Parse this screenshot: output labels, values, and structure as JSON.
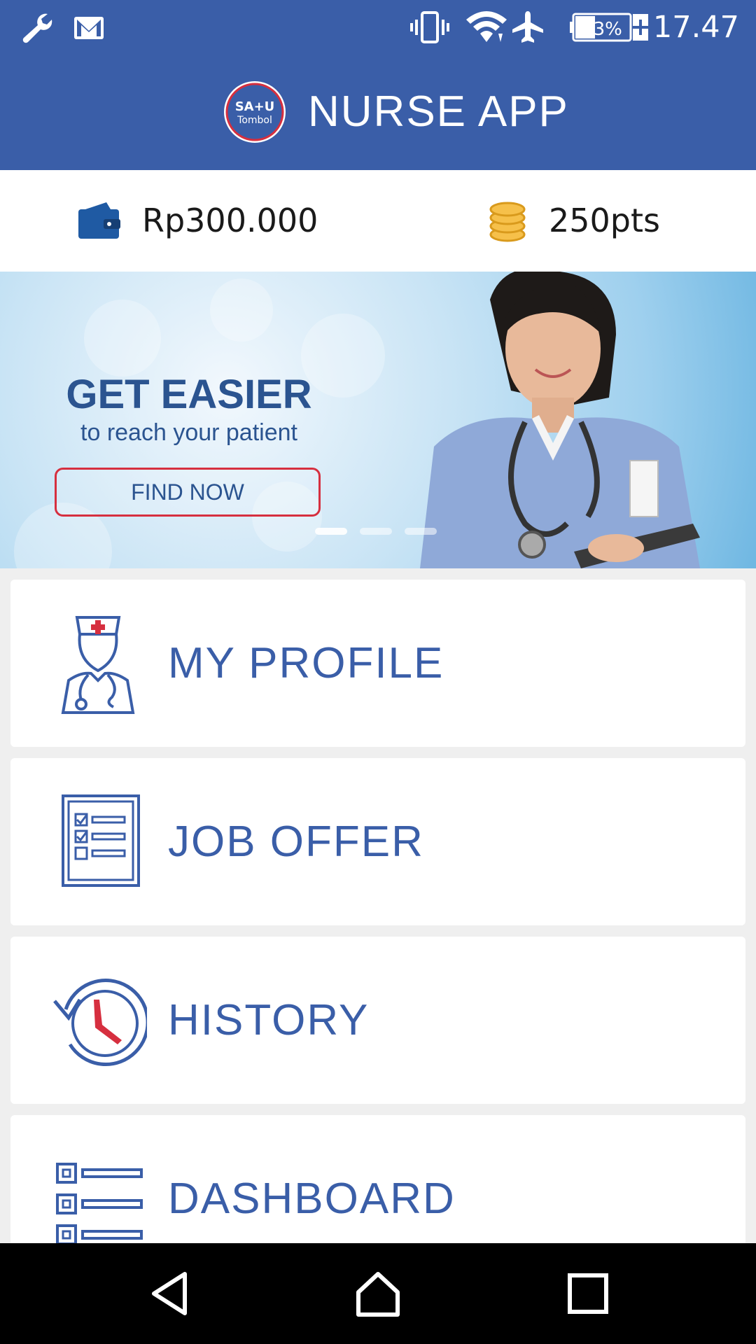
{
  "status_bar": {
    "battery": "33%",
    "time": "17.47",
    "icons": [
      "wrench-icon",
      "gmail-icon",
      "vibrate-icon",
      "wifi-icon",
      "airplane-icon",
      "battery-charging-icon"
    ]
  },
  "app_bar": {
    "logo_text_top": "SA+U",
    "logo_text_bottom": "Tombol",
    "title": "NURSE APP"
  },
  "balance": {
    "wallet_amount": "Rp300.000",
    "points": "250pts"
  },
  "banner": {
    "headline": "GET EASIER",
    "subline": "to reach your patient",
    "cta": "FIND NOW",
    "slides": 3,
    "active_slide": 1
  },
  "menu": {
    "items": [
      {
        "label": "MY PROFILE",
        "icon": "nurse-profile-icon"
      },
      {
        "label": "JOB OFFER",
        "icon": "checklist-icon"
      },
      {
        "label": "HISTORY",
        "icon": "history-clock-icon"
      },
      {
        "label": "DASHBOARD",
        "icon": "dashboard-list-icon"
      }
    ]
  },
  "nav_bar": {
    "buttons": [
      "back-icon",
      "home-icon",
      "recents-icon"
    ]
  },
  "colors": {
    "primary": "#3a5ea8",
    "accent_red": "#d62f3f",
    "coin_gold": "#f0b030",
    "background": "#efefef"
  }
}
